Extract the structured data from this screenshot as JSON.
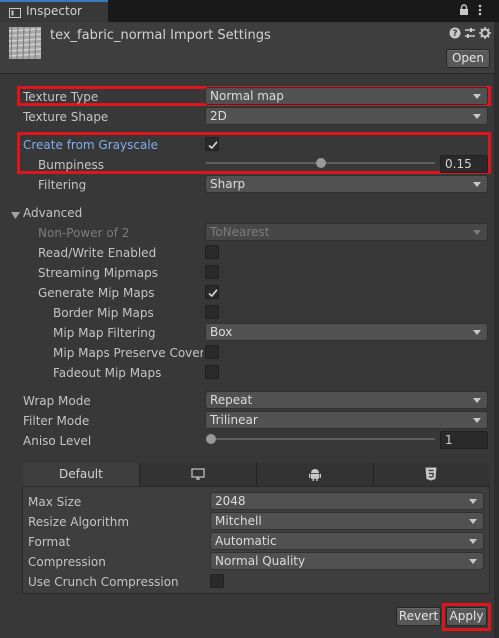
{
  "tab": {
    "label": "Inspector",
    "icon": "info-icon"
  },
  "header": {
    "title": "tex_fabric_normal Import Settings",
    "open_label": "Open",
    "icons": [
      "help-icon",
      "preset-icon",
      "gear-icon"
    ]
  },
  "main": {
    "texture_type": {
      "label": "Texture Type",
      "value": "Normal map"
    },
    "texture_shape": {
      "label": "Texture Shape",
      "value": "2D"
    },
    "create_from_grayscale": {
      "label": "Create from Grayscale",
      "checked": true
    },
    "bumpiness": {
      "label": "Bumpiness",
      "value": "0.15",
      "fraction": 0.5
    },
    "filtering": {
      "label": "Filtering",
      "value": "Sharp"
    },
    "advanced": {
      "label": "Advanced",
      "non_power_of_2": {
        "label": "Non-Power of 2",
        "value": "ToNearest"
      },
      "read_write": {
        "label": "Read/Write Enabled",
        "checked": false
      },
      "streaming_mipmaps": {
        "label": "Streaming Mipmaps",
        "checked": false
      },
      "generate_mip_maps": {
        "label": "Generate Mip Maps",
        "checked": true
      },
      "border_mip_maps": {
        "label": "Border Mip Maps",
        "checked": false
      },
      "mip_map_filtering": {
        "label": "Mip Map Filtering",
        "value": "Box"
      },
      "mip_maps_preserve_coverage": {
        "label": "Mip Maps Preserve Coverage",
        "checked": false
      },
      "fadeout_mip_maps": {
        "label": "Fadeout Mip Maps",
        "checked": false
      }
    },
    "wrap_mode": {
      "label": "Wrap Mode",
      "value": "Repeat"
    },
    "filter_mode": {
      "label": "Filter Mode",
      "value": "Trilinear"
    },
    "aniso_level": {
      "label": "Aniso Level",
      "value": "1",
      "fraction": 0.0
    }
  },
  "platform": {
    "tabs": [
      {
        "label": "Default",
        "icon": ""
      },
      {
        "label": "",
        "icon": "monitor-icon"
      },
      {
        "label": "",
        "icon": "android-icon"
      },
      {
        "label": "",
        "icon": "html5-icon"
      }
    ],
    "max_size": {
      "label": "Max Size",
      "value": "2048"
    },
    "resize_algorithm": {
      "label": "Resize Algorithm",
      "value": "Mitchell"
    },
    "format": {
      "label": "Format",
      "value": "Automatic"
    },
    "compression": {
      "label": "Compression",
      "value": "Normal Quality"
    },
    "use_crunch": {
      "label": "Use Crunch Compression",
      "checked": false
    }
  },
  "footer": {
    "revert_label": "Revert",
    "apply_label": "Apply"
  },
  "colors": {
    "highlight": "#e0141c",
    "accent_blue": "#7eaef1",
    "background": "#383838"
  }
}
